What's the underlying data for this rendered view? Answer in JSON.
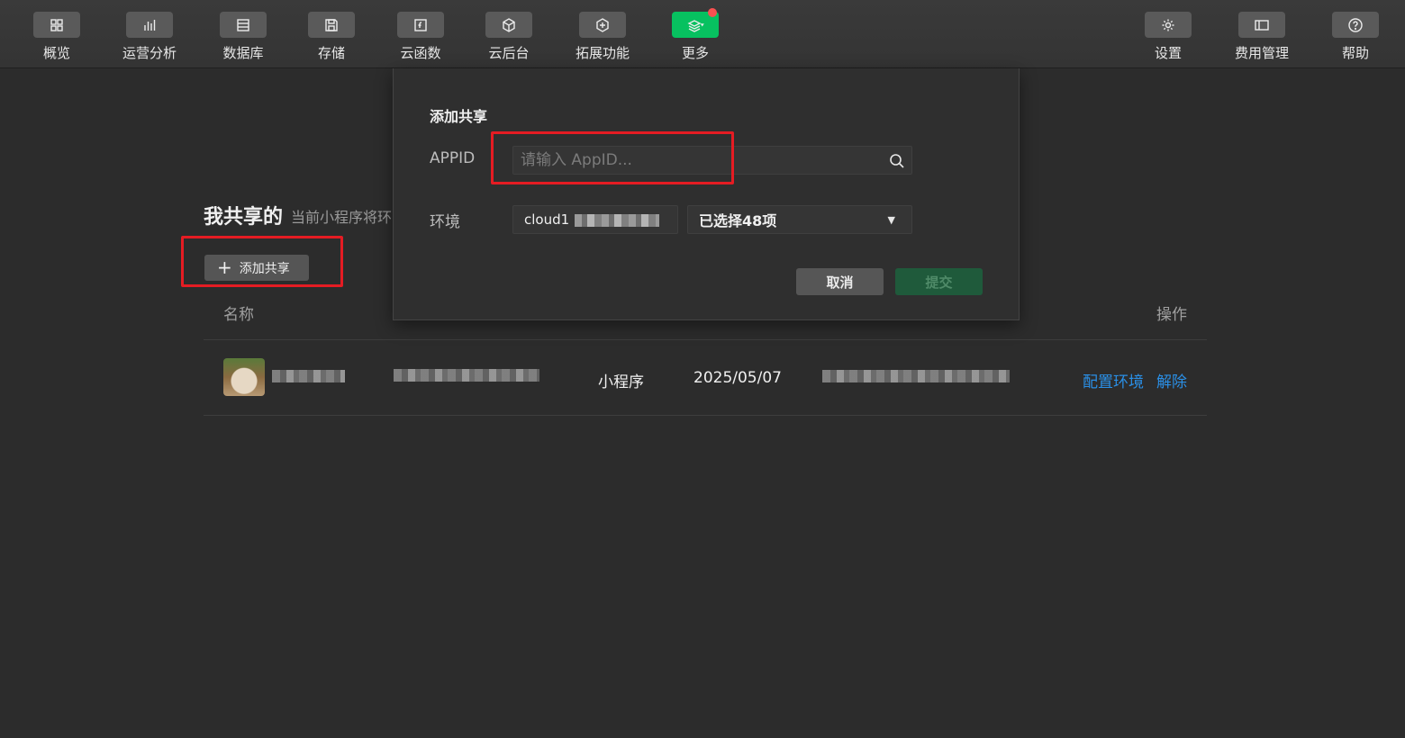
{
  "toolbar": {
    "left_items": [
      {
        "label": "概览",
        "icon": "grid-icon"
      },
      {
        "label": "运营分析",
        "icon": "bar-chart-icon"
      },
      {
        "label": "数据库",
        "icon": "database-icon"
      },
      {
        "label": "存储",
        "icon": "save-icon"
      },
      {
        "label": "云函数",
        "icon": "function-icon"
      },
      {
        "label": "云后台",
        "icon": "cube-icon"
      },
      {
        "label": "拓展功能",
        "icon": "plus-hexagon-icon"
      },
      {
        "label": "更多",
        "icon": "layers-icon"
      }
    ],
    "right_items": [
      {
        "label": "设置",
        "icon": "gear-icon"
      },
      {
        "label": "费用管理",
        "icon": "card-icon"
      },
      {
        "label": "帮助",
        "icon": "help-icon"
      }
    ],
    "accent_color": "#07c160",
    "notification_dot_color": "#fa5151"
  },
  "section": {
    "title": "我共享的",
    "description": "当前小程序将环",
    "add_button": "添加共享"
  },
  "table": {
    "headers": {
      "name": "名称",
      "actions": "操作"
    },
    "rows": [
      {
        "type": "小程序",
        "date": "2025/05/07",
        "action_config": "配置环境",
        "action_remove": "解除"
      }
    ]
  },
  "modal": {
    "title": "添加共享",
    "appid_label": "APPID",
    "appid_placeholder": "请输入 AppID...",
    "env_label": "环境",
    "env_value": "cloud1",
    "selected_text": "已选择48项",
    "cancel": "取消",
    "submit": "提交"
  },
  "colors": {
    "highlight": "#e51c23",
    "link": "#2a8fe6"
  }
}
